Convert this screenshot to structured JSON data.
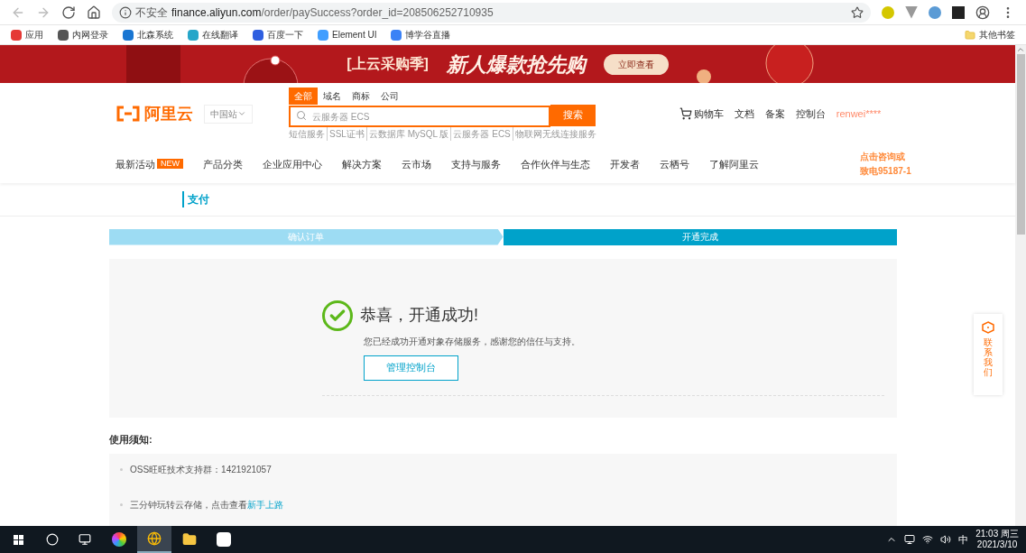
{
  "browser": {
    "security": "不安全",
    "url_host": "finance.aliyun.com",
    "url_path": "/order/paySuccess?order_id=208506252710935"
  },
  "bookmarks": [
    {
      "label": "应用",
      "color": "#e53935"
    },
    {
      "label": "内网登录",
      "color": "#555555"
    },
    {
      "label": "北森系统",
      "color": "#1976d2"
    },
    {
      "label": "在线翻译",
      "color": "#26a6c9"
    },
    {
      "label": "百度一下",
      "color": "#2f5fe0"
    },
    {
      "label": "Element UI",
      "color": "#409eff"
    },
    {
      "label": "博学谷直播",
      "color": "#3b82f6"
    }
  ],
  "other_bookmarks": "其他书签",
  "banner": {
    "tag": "[上云采购季]",
    "headline": "新人爆款抢先购",
    "button": "立即查看"
  },
  "header": {
    "logo": "阿里云",
    "site": "中国站",
    "search_tabs": [
      {
        "label": "全部",
        "selected": true
      },
      {
        "label": "域名",
        "selected": false
      },
      {
        "label": "商标",
        "selected": false
      },
      {
        "label": "公司",
        "selected": false
      }
    ],
    "search_placeholder": "云服务器 ECS",
    "search_button": "搜索",
    "hot_words": [
      "短信服务",
      "SSL证书",
      "云数据库 MySQL 版",
      "云服务器 ECS",
      "物联网无线连接服务"
    ],
    "links": [
      "购物车",
      "文档",
      "备案",
      "控制台"
    ],
    "user": "renwei****",
    "nav": [
      {
        "label": "最新活动",
        "badge": "NEW"
      },
      {
        "label": "产品分类"
      },
      {
        "label": "企业应用中心"
      },
      {
        "label": "解决方案"
      },
      {
        "label": "云市场"
      },
      {
        "label": "支持与服务"
      },
      {
        "label": "合作伙伴与生态"
      },
      {
        "label": "开发者"
      },
      {
        "label": "云栖号"
      },
      {
        "label": "了解阿里云"
      }
    ],
    "hotline": [
      "点击咨询或",
      "致电95187-1"
    ]
  },
  "section_title": "支付",
  "steps": [
    {
      "label": "确认订单",
      "selected": false
    },
    {
      "label": "开通完成",
      "selected": true
    }
  ],
  "result": {
    "title": "恭喜，开通成功!",
    "message": "您已经成功开通对象存储服务，感谢您的信任与支持。",
    "button": "管理控制台"
  },
  "notice": {
    "title": "使用须知:",
    "items": [
      {
        "text": "OSS旺旺技术支持群：1421921057"
      },
      {
        "text": "三分钟玩转云存储，点击查看",
        "link": "新手上路"
      }
    ]
  },
  "contact": "联系我们",
  "taskbar": {
    "time": "21:03 周三",
    "date": "2021/3/10",
    "ime": "中"
  }
}
